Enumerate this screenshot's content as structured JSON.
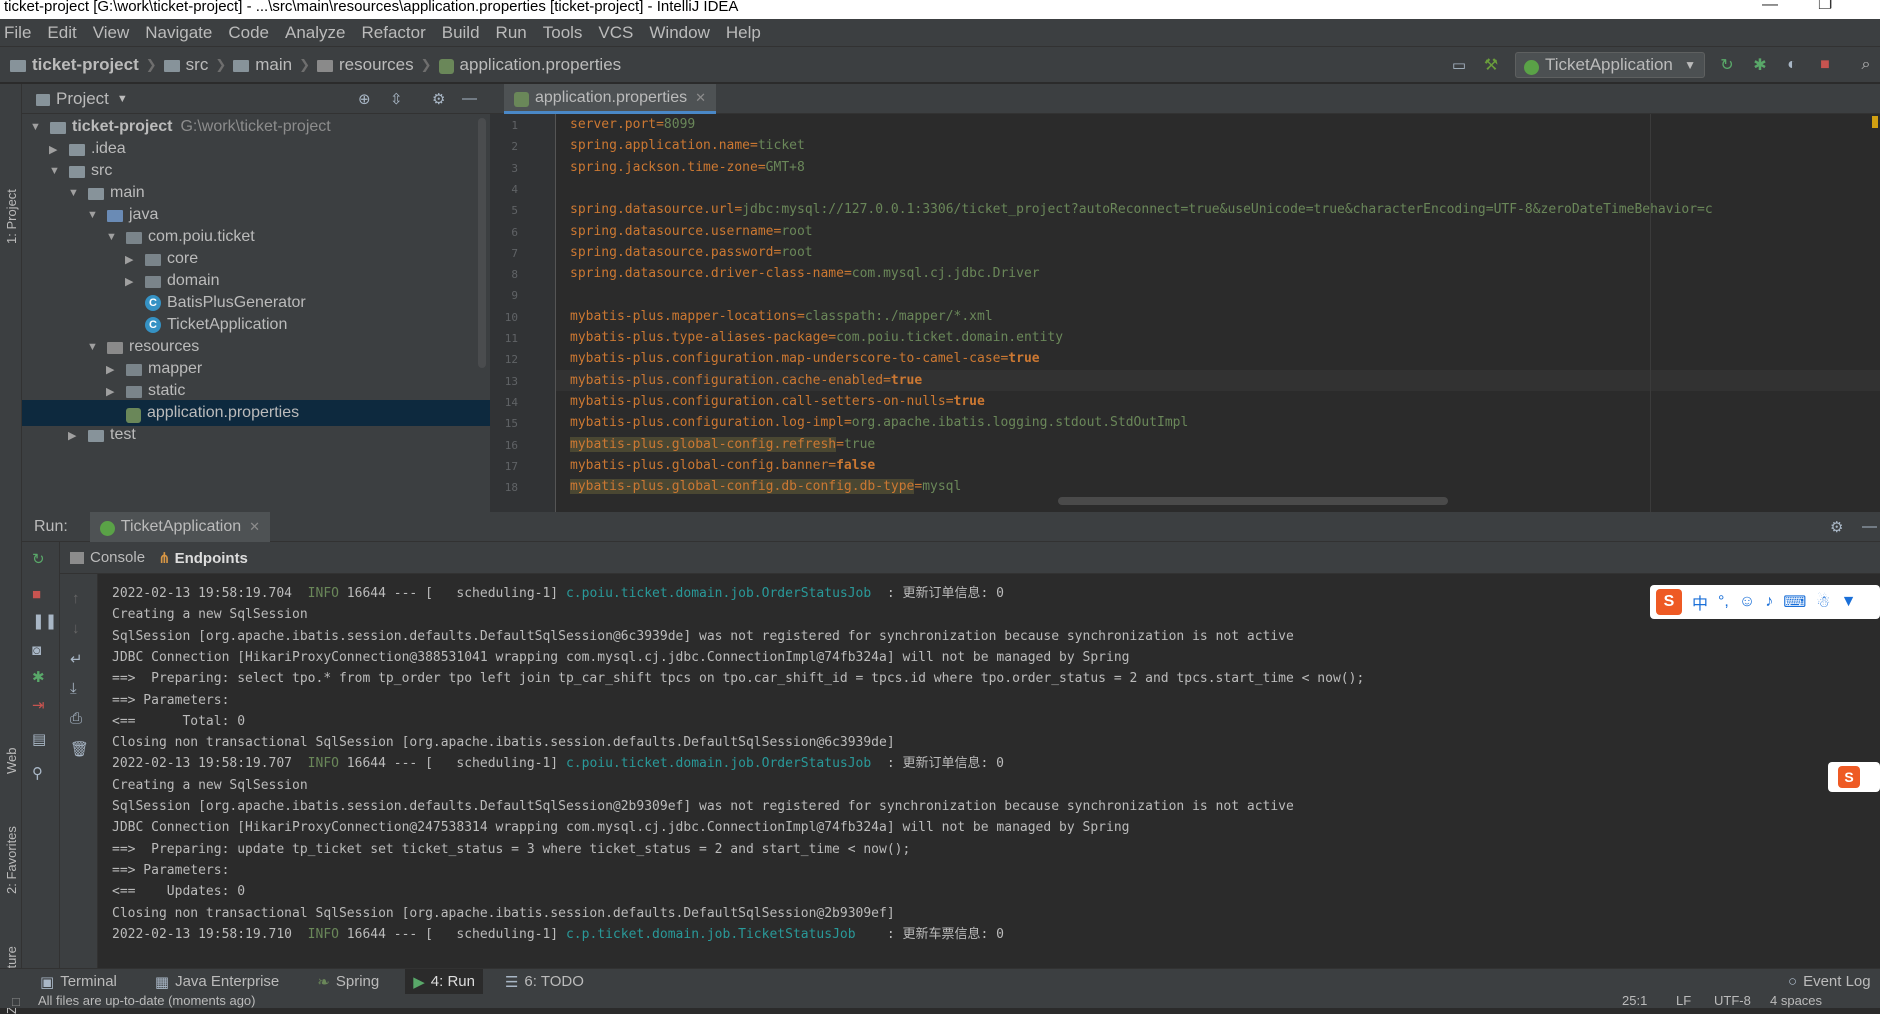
{
  "window": {
    "title": "ticket-project [G:\\work\\ticket-project] - ...\\src\\main\\resources\\application.properties [ticket-project] - IntelliJ IDEA"
  },
  "menu": [
    "File",
    "Edit",
    "View",
    "Navigate",
    "Code",
    "Analyze",
    "Refactor",
    "Build",
    "Run",
    "Tools",
    "VCS",
    "Window",
    "Help"
  ],
  "breadcrumbs": [
    "ticket-project",
    "src",
    "main",
    "resources",
    "application.properties"
  ],
  "run_config": "TicketApplication",
  "project_panel": {
    "title": "Project",
    "tree": [
      {
        "label": "ticket-project",
        "extra": "G:\\work\\ticket-project",
        "indent": 0,
        "arrow": "open",
        "icon": "module"
      },
      {
        "label": ".idea",
        "indent": 1,
        "arrow": "closed",
        "icon": "folder"
      },
      {
        "label": "src",
        "indent": 1,
        "arrow": "open",
        "icon": "folder"
      },
      {
        "label": "main",
        "indent": 2,
        "arrow": "open",
        "icon": "folder"
      },
      {
        "label": "java",
        "indent": 3,
        "arrow": "open",
        "icon": "folder-blue"
      },
      {
        "label": "com.poiu.ticket",
        "indent": 4,
        "arrow": "open",
        "icon": "package"
      },
      {
        "label": "core",
        "indent": 5,
        "arrow": "closed",
        "icon": "package"
      },
      {
        "label": "domain",
        "indent": 5,
        "arrow": "closed",
        "icon": "package"
      },
      {
        "label": "BatisPlusGenerator",
        "indent": 5,
        "arrow": "none",
        "icon": "java"
      },
      {
        "label": "TicketApplication",
        "indent": 5,
        "arrow": "none",
        "icon": "java"
      },
      {
        "label": "resources",
        "indent": 3,
        "arrow": "open",
        "icon": "folder-res"
      },
      {
        "label": "mapper",
        "indent": 4,
        "arrow": "closed",
        "icon": "package"
      },
      {
        "label": "static",
        "indent": 4,
        "arrow": "closed",
        "icon": "package"
      },
      {
        "label": "application.properties",
        "indent": 4,
        "arrow": "none",
        "icon": "properties",
        "selected": true
      },
      {
        "label": "test",
        "indent": 2,
        "arrow": "closed",
        "icon": "folder"
      }
    ]
  },
  "editor": {
    "tab_label": "application.properties",
    "lines": [
      {
        "n": "1",
        "key": "server.port",
        "val": "8099"
      },
      {
        "n": "2",
        "key": "spring.application.name",
        "val": "ticket"
      },
      {
        "n": "3",
        "key": "spring.jackson.time-zone",
        "val": "GMT+8"
      },
      {
        "n": "4",
        "key": "",
        "val": ""
      },
      {
        "n": "5",
        "key": "spring.datasource.url",
        "val": "jdbc:mysql://127.0.0.1:3306/ticket_project?autoReconnect=true&useUnicode=true&characterEncoding=UTF-8&zeroDateTimeBehavior=c"
      },
      {
        "n": "6",
        "key": "spring.datasource.username",
        "val": "root"
      },
      {
        "n": "7",
        "key": "spring.datasource.password",
        "val": "root"
      },
      {
        "n": "8",
        "key": "spring.datasource.driver-class-name",
        "val": "com.mysql.cj.jdbc.Driver"
      },
      {
        "n": "9",
        "key": "",
        "val": ""
      },
      {
        "n": "10",
        "key": "mybatis-plus.mapper-locations",
        "val": "classpath:./mapper/*.xml"
      },
      {
        "n": "11",
        "key": "mybatis-plus.type-aliases-package",
        "val": "com.poiu.ticket.domain.entity"
      },
      {
        "n": "12",
        "key": "mybatis-plus.configuration.map-underscore-to-camel-case",
        "val": "true",
        "bool": true
      },
      {
        "n": "13",
        "key": "mybatis-plus.configuration.cache-enabled",
        "val": "true",
        "bool": true
      },
      {
        "n": "14",
        "key": "mybatis-plus.configuration.call-setters-on-nulls",
        "val": "true",
        "bool": true
      },
      {
        "n": "15",
        "key": "mybatis-plus.configuration.log-impl",
        "val": "org.apache.ibatis.logging.stdout.StdOutImpl"
      },
      {
        "n": "16",
        "key": "mybatis-plus.global-config.refresh",
        "val": "true",
        "hl": true
      },
      {
        "n": "17",
        "key": "mybatis-plus.global-config.banner",
        "val": "false",
        "bool": true
      },
      {
        "n": "18",
        "key": "mybatis-plus.global-config.db-config.db-type",
        "val": "mysql",
        "hl": true
      }
    ]
  },
  "run_panel": {
    "label": "Run:",
    "tab": "TicketApplication",
    "subtabs": [
      "Console",
      "Endpoints"
    ],
    "console": [
      {
        "pre": "2022-02-13 19:58:19.704  ",
        "level": "INFO",
        "mid": " 16644 --- [   scheduling-1] ",
        "logger": "c.poiu.ticket.domain.job.OrderStatusJob",
        "msg": "  : 更新订单信息: 0"
      },
      {
        "text": "Creating a new SqlSession"
      },
      {
        "text": "SqlSession [org.apache.ibatis.session.defaults.DefaultSqlSession@6c3939de] was not registered for synchronization because synchronization is not active"
      },
      {
        "text": "JDBC Connection [HikariProxyConnection@388531041 wrapping com.mysql.cj.jdbc.ConnectionImpl@74fb324a] will not be managed by Spring"
      },
      {
        "text": "==>  Preparing: select tpo.* from tp_order tpo left join tp_car_shift tpcs on tpo.car_shift_id = tpcs.id where tpo.order_status = 2 and tpcs.start_time < now();"
      },
      {
        "text": "==> Parameters: "
      },
      {
        "text": "<==      Total: 0"
      },
      {
        "text": "Closing non transactional SqlSession [org.apache.ibatis.session.defaults.DefaultSqlSession@6c3939de]"
      },
      {
        "pre": "2022-02-13 19:58:19.707  ",
        "level": "INFO",
        "mid": " 16644 --- [   scheduling-1] ",
        "logger": "c.poiu.ticket.domain.job.OrderStatusJob",
        "msg": "  : 更新订单信息: 0"
      },
      {
        "text": "Creating a new SqlSession"
      },
      {
        "text": "SqlSession [org.apache.ibatis.session.defaults.DefaultSqlSession@2b9309ef] was not registered for synchronization because synchronization is not active"
      },
      {
        "text": "JDBC Connection [HikariProxyConnection@247538314 wrapping com.mysql.cj.jdbc.ConnectionImpl@74fb324a] will not be managed by Spring"
      },
      {
        "text": "==>  Preparing: update tp_ticket set ticket_status = 3 where ticket_status = 2 and start_time < now();"
      },
      {
        "text": "==> Parameters: "
      },
      {
        "text": "<==    Updates: 0"
      },
      {
        "text": "Closing non transactional SqlSession [org.apache.ibatis.session.defaults.DefaultSqlSession@2b9309ef]"
      },
      {
        "pre": "2022-02-13 19:58:19.710  ",
        "level": "INFO",
        "mid": " 16644 --- [   scheduling-1] ",
        "logger": "c.p.ticket.domain.job.TicketStatusJob",
        "msg": "    : 更新车票信息: 0"
      }
    ]
  },
  "bottom_tabs": [
    "Terminal",
    "Java Enterprise",
    "Spring",
    "4: Run",
    "6: TODO"
  ],
  "event_log": "Event Log",
  "status": {
    "message": "All files are up-to-date (moments ago)",
    "position": "25:1",
    "line_sep": "LF",
    "encoding": "UTF-8",
    "indent": "4 spaces"
  },
  "side_labels": {
    "project": "1: Project",
    "web": "Web",
    "favorites": "2: Favorites",
    "structure": "Z: Structure"
  },
  "colors": {
    "bg": "#2b2b2b",
    "panel": "#3c3f41",
    "key": "#cc7832",
    "value": "#6a8759",
    "logger": "#299999",
    "selection": "#0d293e"
  }
}
